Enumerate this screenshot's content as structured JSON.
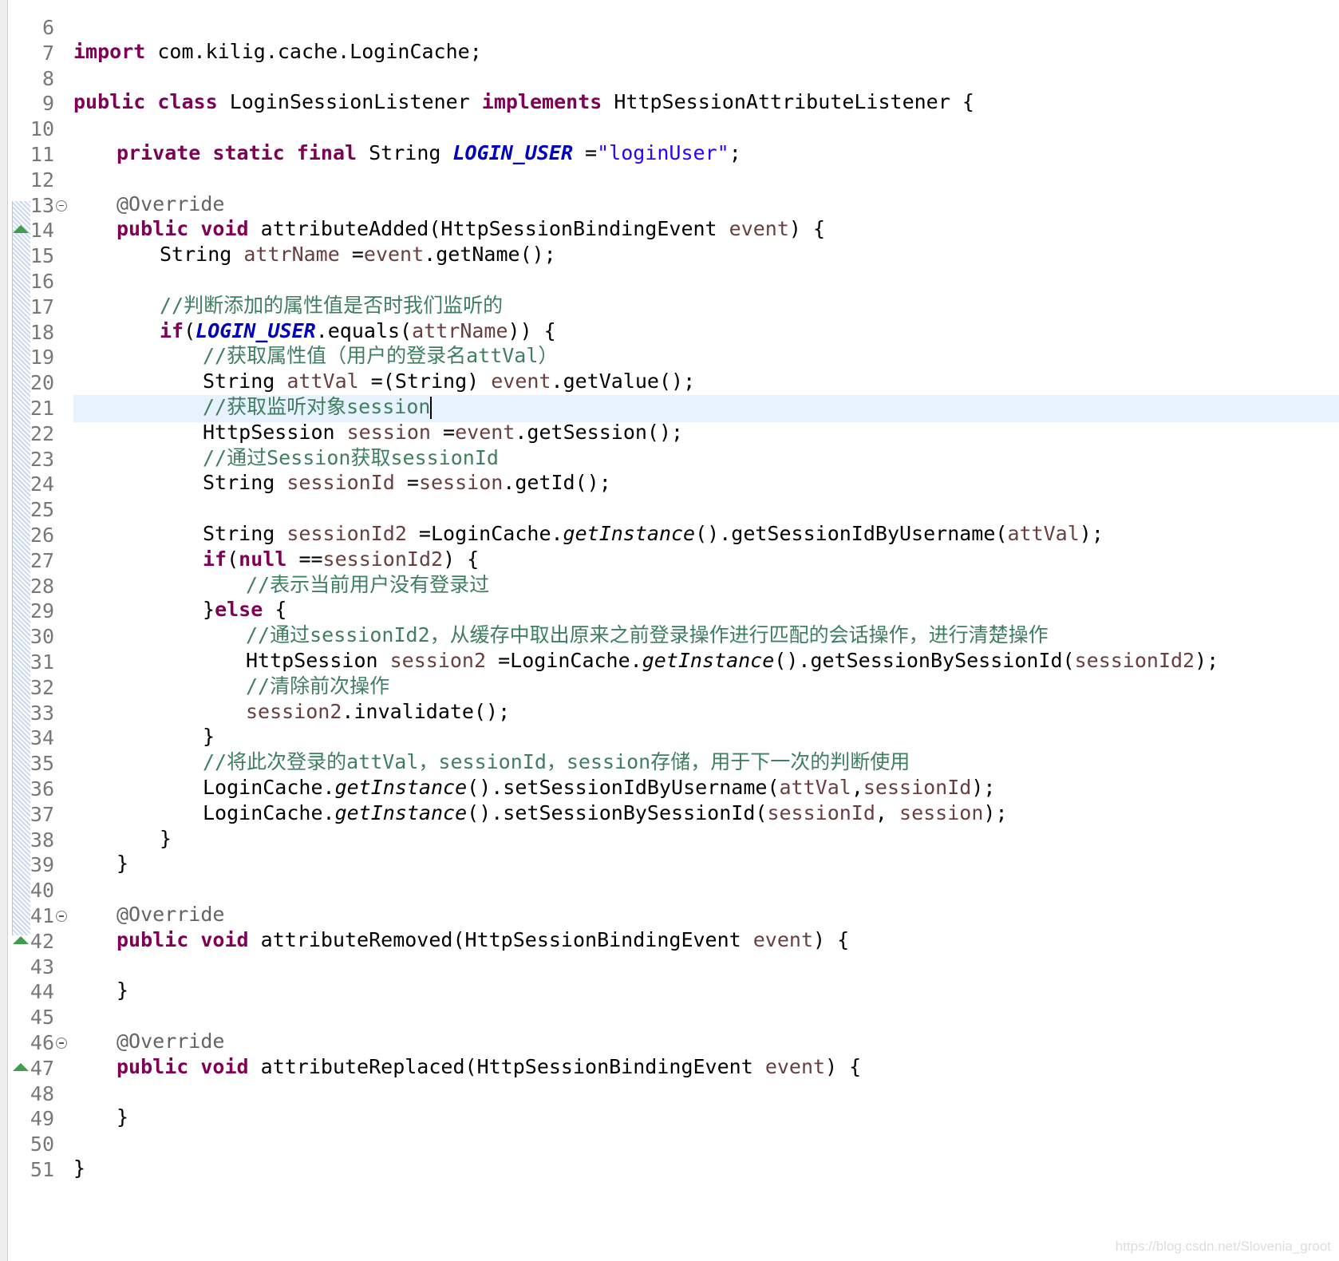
{
  "editor": {
    "lines": [
      {
        "n": "6"
      },
      {
        "n": "7",
        "tokens": [
          {
            "t": "import",
            "c": "kw"
          },
          {
            "t": " com.kilig.cache.LoginCache;"
          }
        ]
      },
      {
        "n": "8"
      },
      {
        "n": "9",
        "tokens": [
          {
            "t": "public",
            "c": "kw"
          },
          {
            "t": " "
          },
          {
            "t": "class",
            "c": "kw"
          },
          {
            "t": " LoginSessionListener "
          },
          {
            "t": "implements",
            "c": "kw"
          },
          {
            "t": " HttpSessionAttributeListener {"
          }
        ]
      },
      {
        "n": "10"
      },
      {
        "n": "11",
        "indent": 1,
        "tokens": [
          {
            "t": "private",
            "c": "kw"
          },
          {
            "t": " "
          },
          {
            "t": "static",
            "c": "kw"
          },
          {
            "t": " "
          },
          {
            "t": "final",
            "c": "kw"
          },
          {
            "t": " String "
          },
          {
            "t": "LOGIN_USER",
            "c": "const"
          },
          {
            "t": " ="
          },
          {
            "t": "\"loginUser\"",
            "c": "str"
          },
          {
            "t": ";"
          }
        ]
      },
      {
        "n": "12"
      },
      {
        "n": "13",
        "fold": true,
        "indent": 1,
        "tokens": [
          {
            "t": "@Override",
            "c": "ann"
          }
        ]
      },
      {
        "n": "14",
        "override": true,
        "indent": 1,
        "tokens": [
          {
            "t": "public",
            "c": "kw"
          },
          {
            "t": " "
          },
          {
            "t": "void",
            "c": "kw"
          },
          {
            "t": " attributeAdded(HttpSessionBindingEvent "
          },
          {
            "t": "event",
            "c": "var"
          },
          {
            "t": ") {"
          }
        ]
      },
      {
        "n": "15",
        "indent": 2,
        "tokens": [
          {
            "t": "String "
          },
          {
            "t": "attrName",
            "c": "var"
          },
          {
            "t": " ="
          },
          {
            "t": "event",
            "c": "var"
          },
          {
            "t": ".getName();"
          }
        ]
      },
      {
        "n": "16"
      },
      {
        "n": "17",
        "indent": 2,
        "tokens": [
          {
            "t": "//判断添加的属性值是否时我们监听的",
            "c": "cmt"
          }
        ]
      },
      {
        "n": "18",
        "indent": 2,
        "tokens": [
          {
            "t": "if",
            "c": "kw"
          },
          {
            "t": "("
          },
          {
            "t": "LOGIN_USER",
            "c": "const"
          },
          {
            "t": ".equals("
          },
          {
            "t": "attrName",
            "c": "var"
          },
          {
            "t": ")) {"
          }
        ]
      },
      {
        "n": "19",
        "indent": 3,
        "tokens": [
          {
            "t": "//获取属性值（用户的登录名attVal）",
            "c": "cmt"
          }
        ]
      },
      {
        "n": "20",
        "indent": 3,
        "tokens": [
          {
            "t": "String "
          },
          {
            "t": "attVal",
            "c": "var"
          },
          {
            "t": " =(String) "
          },
          {
            "t": "event",
            "c": "var"
          },
          {
            "t": ".getValue();"
          }
        ]
      },
      {
        "n": "21",
        "indent": 3,
        "current": true,
        "caret": true,
        "tokens": [
          {
            "t": "//获取监听对象session",
            "c": "cmt"
          }
        ]
      },
      {
        "n": "22",
        "indent": 3,
        "tokens": [
          {
            "t": "HttpSession "
          },
          {
            "t": "session",
            "c": "var"
          },
          {
            "t": " ="
          },
          {
            "t": "event",
            "c": "var"
          },
          {
            "t": ".getSession();"
          }
        ]
      },
      {
        "n": "23",
        "indent": 3,
        "tokens": [
          {
            "t": "//通过Session获取sessionId",
            "c": "cmt"
          }
        ]
      },
      {
        "n": "24",
        "indent": 3,
        "tokens": [
          {
            "t": "String "
          },
          {
            "t": "sessionId",
            "c": "var"
          },
          {
            "t": " ="
          },
          {
            "t": "session",
            "c": "var"
          },
          {
            "t": ".getId();"
          }
        ]
      },
      {
        "n": "25"
      },
      {
        "n": "26",
        "indent": 3,
        "tokens": [
          {
            "t": "String "
          },
          {
            "t": "sessionId2",
            "c": "var"
          },
          {
            "t": " =LoginCache."
          },
          {
            "t": "getInstance",
            "c": "static-call"
          },
          {
            "t": "().getSessionIdByUsername("
          },
          {
            "t": "attVal",
            "c": "var"
          },
          {
            "t": ");"
          }
        ]
      },
      {
        "n": "27",
        "indent": 3,
        "tokens": [
          {
            "t": "if",
            "c": "kw"
          },
          {
            "t": "("
          },
          {
            "t": "null",
            "c": "kw"
          },
          {
            "t": " =="
          },
          {
            "t": "sessionId2",
            "c": "var"
          },
          {
            "t": ") {"
          }
        ]
      },
      {
        "n": "28",
        "indent": 4,
        "tokens": [
          {
            "t": "//表示当前用户没有登录过",
            "c": "cmt"
          }
        ]
      },
      {
        "n": "29",
        "indent": 3,
        "tokens": [
          {
            "t": "}"
          },
          {
            "t": "else",
            "c": "kw"
          },
          {
            "t": " {"
          }
        ]
      },
      {
        "n": "30",
        "indent": 4,
        "tokens": [
          {
            "t": "//通过sessionId2，从缓存中取出原来之前登录操作进行匹配的会话操作，进行清楚操作",
            "c": "cmt"
          }
        ]
      },
      {
        "n": "31",
        "indent": 4,
        "tokens": [
          {
            "t": "HttpSession "
          },
          {
            "t": "session2",
            "c": "var"
          },
          {
            "t": " =LoginCache."
          },
          {
            "t": "getInstance",
            "c": "static-call"
          },
          {
            "t": "().getSessionBySessionId("
          },
          {
            "t": "sessionId2",
            "c": "var"
          },
          {
            "t": ");"
          }
        ]
      },
      {
        "n": "32",
        "indent": 4,
        "tokens": [
          {
            "t": "//清除前次操作",
            "c": "cmt"
          }
        ]
      },
      {
        "n": "33",
        "indent": 4,
        "tokens": [
          {
            "t": "session2",
            "c": "var"
          },
          {
            "t": ".invalidate();"
          }
        ]
      },
      {
        "n": "34",
        "indent": 3,
        "tokens": [
          {
            "t": "}"
          }
        ]
      },
      {
        "n": "35",
        "indent": 3,
        "tokens": [
          {
            "t": "//将此次登录的attVal，sessionId，session存储，用于下一次的判断使用",
            "c": "cmt"
          }
        ]
      },
      {
        "n": "36",
        "indent": 3,
        "tokens": [
          {
            "t": "LoginCache."
          },
          {
            "t": "getInstance",
            "c": "static-call"
          },
          {
            "t": "().setSessionIdByUsername("
          },
          {
            "t": "attVal",
            "c": "var"
          },
          {
            "t": ","
          },
          {
            "t": "sessionId",
            "c": "var"
          },
          {
            "t": ");"
          }
        ]
      },
      {
        "n": "37",
        "indent": 3,
        "tokens": [
          {
            "t": "LoginCache."
          },
          {
            "t": "getInstance",
            "c": "static-call"
          },
          {
            "t": "().setSessionBySessionId("
          },
          {
            "t": "sessionId",
            "c": "var"
          },
          {
            "t": ", "
          },
          {
            "t": "session",
            "c": "var"
          },
          {
            "t": ");"
          }
        ]
      },
      {
        "n": "38",
        "indent": 2,
        "tokens": [
          {
            "t": "}"
          }
        ]
      },
      {
        "n": "39",
        "indent": 1,
        "tokens": [
          {
            "t": "}"
          }
        ]
      },
      {
        "n": "40"
      },
      {
        "n": "41",
        "fold": true,
        "indent": 1,
        "tokens": [
          {
            "t": "@Override",
            "c": "ann"
          }
        ]
      },
      {
        "n": "42",
        "override": true,
        "indent": 1,
        "tokens": [
          {
            "t": "public",
            "c": "kw"
          },
          {
            "t": " "
          },
          {
            "t": "void",
            "c": "kw"
          },
          {
            "t": " attributeRemoved(HttpSessionBindingEvent "
          },
          {
            "t": "event",
            "c": "var"
          },
          {
            "t": ") {"
          }
        ]
      },
      {
        "n": "43"
      },
      {
        "n": "44",
        "indent": 1,
        "tokens": [
          {
            "t": "}"
          }
        ]
      },
      {
        "n": "45"
      },
      {
        "n": "46",
        "fold": true,
        "indent": 1,
        "tokens": [
          {
            "t": "@Override",
            "c": "ann"
          }
        ]
      },
      {
        "n": "47",
        "override": true,
        "indent": 1,
        "tokens": [
          {
            "t": "public",
            "c": "kw"
          },
          {
            "t": " "
          },
          {
            "t": "void",
            "c": "kw"
          },
          {
            "t": " attributeReplaced(HttpSessionBindingEvent "
          },
          {
            "t": "event",
            "c": "var"
          },
          {
            "t": ") {"
          }
        ]
      },
      {
        "n": "48"
      },
      {
        "n": "49",
        "indent": 1,
        "tokens": [
          {
            "t": "}"
          }
        ]
      },
      {
        "n": "50"
      },
      {
        "n": "51",
        "tokens": [
          {
            "t": "}"
          }
        ]
      }
    ]
  },
  "watermark": "https://blog.csdn.net/Slovenia_groot"
}
